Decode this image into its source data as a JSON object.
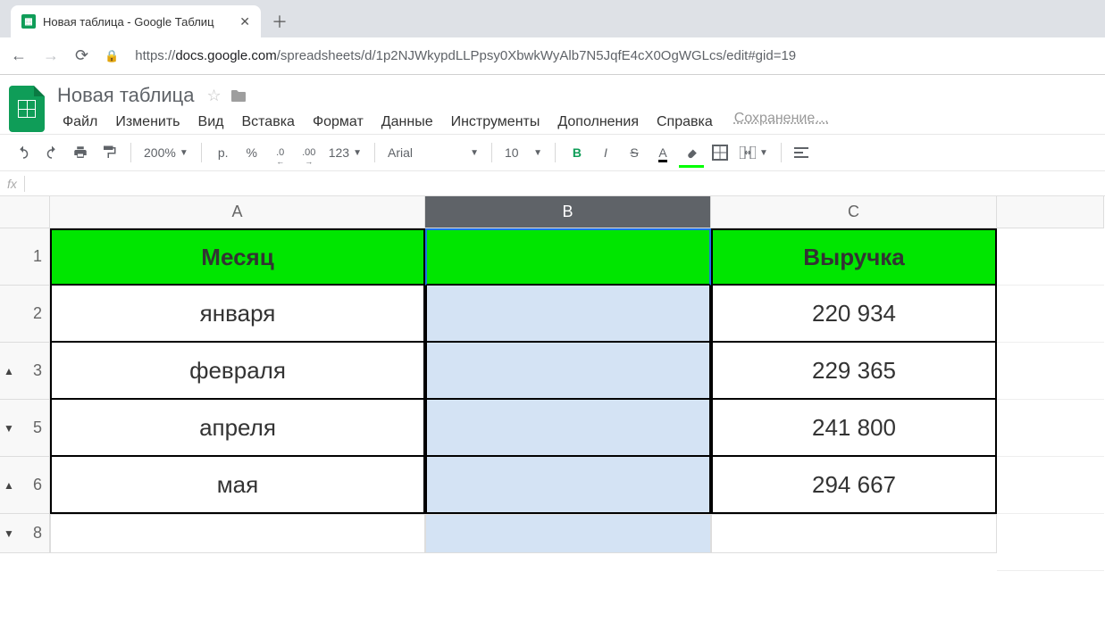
{
  "browser": {
    "tab_title": "Новая таблица - Google Таблиц",
    "url_prefix": "https://",
    "url_domain": "docs.google.com",
    "url_path": "/spreadsheets/d/1p2NJWkypdLLPpsy0XbwkWyAlb7N5JqfE4cX0OgWGLcs/edit#gid=19"
  },
  "doc": {
    "title": "Новая таблица",
    "menus": [
      "Файл",
      "Изменить",
      "Вид",
      "Вставка",
      "Формат",
      "Данные",
      "Инструменты",
      "Дополнения",
      "Справка"
    ],
    "save_status": "Сохранение…"
  },
  "toolbar": {
    "zoom": "200%",
    "currency": "р.",
    "percent": "%",
    "dec_dec": ".0",
    "dec_inc": ".00",
    "more_formats": "123",
    "font": "Arial",
    "font_size": "10",
    "bold": "B",
    "italic": "I",
    "strike": "S",
    "text_color": "A"
  },
  "grid": {
    "columns": [
      "A",
      "B",
      "C"
    ],
    "selected_column": "B",
    "rows": [
      {
        "num": "1",
        "group": "",
        "A": "Месяц",
        "B": "",
        "C": "Выручка",
        "header": true
      },
      {
        "num": "2",
        "group": "",
        "A": "января",
        "B": "",
        "C": "220 934"
      },
      {
        "num": "3",
        "group": "▲",
        "A": "февраля",
        "B": "",
        "C": "229 365"
      },
      {
        "num": "5",
        "group": "▼",
        "A": "апреля",
        "B": "",
        "C": "241 800"
      },
      {
        "num": "6",
        "group": "▲",
        "A": "мая",
        "B": "",
        "C": "294 667"
      },
      {
        "num": "8",
        "group": "▼",
        "A": "",
        "B": "",
        "C": "",
        "trailing": true
      }
    ]
  }
}
